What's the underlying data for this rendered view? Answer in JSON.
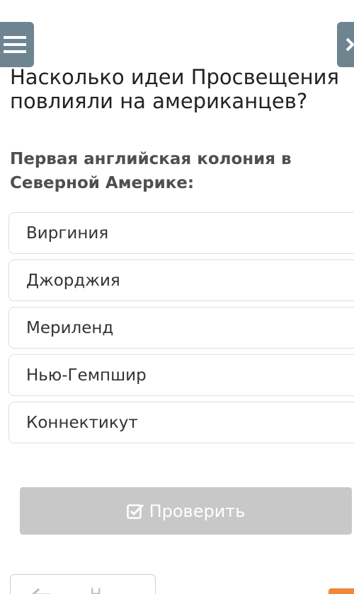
{
  "question": {
    "title": "Насколько идеи Просвещения повлияли на американцев?",
    "prompt": "Первая английская колония в Северной Америке:"
  },
  "options": [
    {
      "label": "Виргиния"
    },
    {
      "label": "Джорджия"
    },
    {
      "label": "Мериленд"
    },
    {
      "label": "Нью-Гемпшир"
    },
    {
      "label": "Коннектикут"
    }
  ],
  "actions": {
    "check_label": "Проверить",
    "back_label": "Н"
  },
  "icons": {
    "menu": "hamburger-menu-icon",
    "next": "chevron-right-icon",
    "check": "checkbox-check-icon",
    "back": "arrow-left-icon"
  },
  "colors": {
    "nav_button": "#6f8491",
    "check_button_disabled": "#c8c8c8",
    "accent_orange": "#f0883a"
  }
}
